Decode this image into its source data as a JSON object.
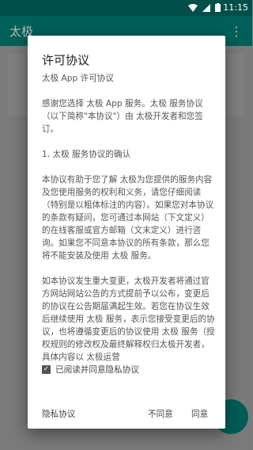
{
  "status_bar": {
    "time": "11:15"
  },
  "app_bar": {
    "title": "太极",
    "menu_icon": "⋮"
  },
  "dialog": {
    "title": "许可协议",
    "paragraphs": [
      "太极 App 许可协议",
      "感谢您选择 太极 App 服务。太极 服务协议（以下简称\"本协议\"）由 太极开发者和您签订。",
      "1. 太极 服务协议的确认",
      "本协议有助于您了解 太极为您提供的服务内容及您使用服务的权利和义务，请您仔细阅读（特别是以粗体标注的内容）。如果您对本协议的条款有疑问，您可通过本网站（下文定义）的在线客服或官方邮箱（文末定义）进行咨询。如果您不同意本协议的所有条款，那么您将不能安装及使用 太极 服务。",
      "如本协议发生重大变更，太极开发者将通过官方网站网站公告的方式提前予以公布，变更后的协议在公告期届满起生效。若您在协议生效后继续使用 太极 服务，表示您接受变更后的协议，也将遵循变更后的协议使用 太极 服务（授权规则的修改权及最终解释权归太极开发者，具体内容以 太极运营"
    ],
    "checkbox_label": "已阅读并同意隐私协议",
    "checkbox_checked": true,
    "buttons": {
      "privacy": "隐私协议",
      "disagree": "不同意",
      "agree": "同意"
    }
  }
}
